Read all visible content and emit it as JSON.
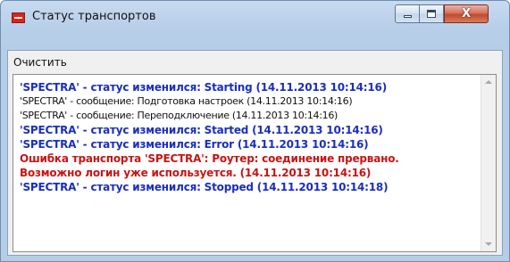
{
  "window": {
    "title": "Статус транспортов",
    "close_glyph": "X"
  },
  "toolbar": {
    "clear_label": "Очистить"
  },
  "log": [
    {
      "text": "'SPECTRA' - статус изменился: Starting (14.11.2013 10:14:16)",
      "kind": "status"
    },
    {
      "text": "'SPECTRA' - сообщение: Подготовка настроек (14.11.2013 10:14:16)",
      "kind": "normal"
    },
    {
      "text": "'SPECTRA' - сообщение: Переподключение (14.11.2013 10:14:16)",
      "kind": "normal"
    },
    {
      "text": "'SPECTRA' - статус изменился: Started (14.11.2013 10:14:16)",
      "kind": "status"
    },
    {
      "text": "'SPECTRA' - статус изменился: Error (14.11.2013 10:14:16)",
      "kind": "status"
    },
    {
      "text": "Ошибка транспорта 'SPECTRA': Роутер: соединение прервано.",
      "kind": "error"
    },
    {
      "text": "Возможно логин уже используется. (14.11.2013 10:14:16)",
      "kind": "error"
    },
    {
      "text": "'SPECTRA' - статус изменился: Stopped (14.11.2013 10:14:18)",
      "kind": "status"
    }
  ],
  "colors": {
    "status": "#1a2fbf",
    "error": "#c81414",
    "normal": "#111111"
  },
  "icons": {
    "app": "app-icon",
    "minimize": "minimize-icon",
    "maximize": "maximize-icon",
    "close": "close-icon",
    "scroll_up": "scroll-up-arrow-icon",
    "scroll_down": "scroll-down-arrow-icon"
  }
}
